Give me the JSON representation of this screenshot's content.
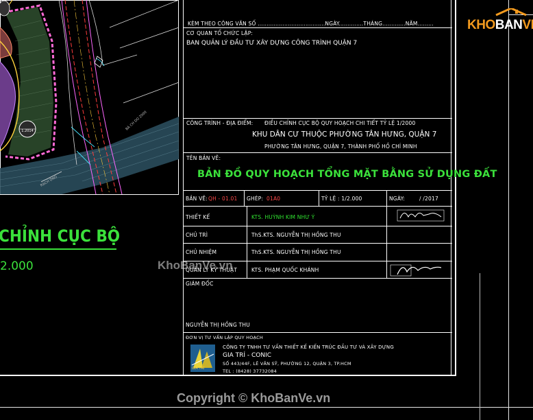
{
  "drawing": {
    "left_title": "CHỈNH CỤC BỘ",
    "left_scale": "2.000",
    "road_label_1": "BÁ CH DO 2000",
    "road_label_2": "RẠCH ÔNG",
    "lot_label": "1.2014"
  },
  "titleblock": {
    "kem_theo": "KÈM THEO CÔNG VĂN SỐ ......................................NGÀY..............THÁNG.............NĂM.........",
    "co_quan_label": "CƠ QUAN TỔ CHỨC LẬP:",
    "co_quan_value": "BAN QUẢN LÝ ĐẦU TƯ XÂY DỰNG CÔNG TRÌNH QUẬN 7",
    "cong_trinh_label": "CÔNG TRÌNH - ĐỊA ĐIỂM:",
    "cong_trinh_line1": "ĐIỀU CHỈNH CỤC BỘ QUY HOẠCH CHI TIẾT TỶ LỆ 1/2000",
    "cong_trinh_line2": "KHU DÂN CƯ THUỘC PHƯỜNG TÂN HƯNG, QUẬN 7",
    "cong_trinh_line3": "PHƯỜNG TÂN HƯNG, QUẬN 7, THÀNH PHỐ HỒ CHÍ MINH",
    "ten_ban_ve_label": "TÊN BẢN VẼ:",
    "ten_ban_ve_value": "BẢN ĐỒ QUY HOẠCH TỔNG MẶT BẰNG SỬ DỤNG ĐẤT",
    "ban_ve_label": "BẢN VẼ:",
    "ban_ve_value": "QH - 01.01",
    "ghep_label": "GHÉP:",
    "ghep_value": "01A0",
    "ty_le": "TỶ LỆ : 1/2.000",
    "ngay_label": "NGÀY:",
    "ngay_value": "/      /2017",
    "rows": [
      {
        "role": "THIẾT KẾ",
        "name": "KTS. HUỲNH KIM NHƯ Ý",
        "green": true
      },
      {
        "role": "CHỦ TRÌ",
        "name": "ThS.KTS. NGUYỄN THỊ HỒNG THU",
        "green": false
      },
      {
        "role": "CHỦ NHIỆM",
        "name": "ThS.KTS. NGUYỄN THỊ HỒNG THU",
        "green": false
      },
      {
        "role": "QUẢN LÝ KỸ THUẬT",
        "name": "KTS. PHẠM QUỐC KHÁNH",
        "green": false
      }
    ],
    "giam_doc_label": "GIÁM ĐỐC",
    "giam_doc_name": "NGUYỄN THỊ HỒNG THU",
    "don_vi_label": "ĐƠN VỊ TƯ VẤN LẬP QUY HOẠCH",
    "company_line1": "CÔNG TY TNHH TƯ VẤN THIẾT KẾ KIẾN TRÚC ĐẦU TƯ VÀ XÂY DỰNG",
    "company_line2": "GIA TRÍ - CONIC",
    "company_addr": "SỐ 443/44F, LÊ VĂN SỸ, PHƯỜNG 12, QUẬN 3, TP.HCM",
    "company_tel": "TEL : (8428) 37732084",
    "company_logo_text": "GIA TRÍ"
  },
  "branding": {
    "logo_text_1": "KHO",
    "logo_text_2": "BAN",
    "logo_text_3": "VE",
    "watermark_mid": "KhoBanVe.vn",
    "copyright": "Copyright © KhoBanVe.vn"
  },
  "colors": {
    "background": "#000000",
    "title_green": "#3be13b",
    "logo_orange": "#f39a1e"
  }
}
